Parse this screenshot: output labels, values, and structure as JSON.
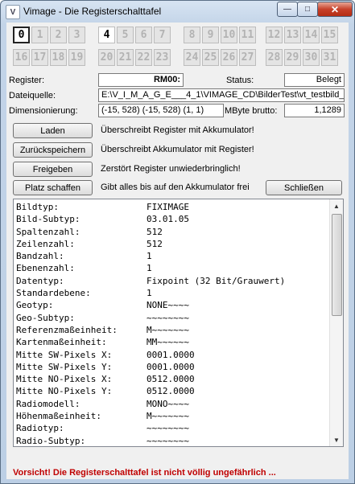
{
  "window": {
    "title": "Vimage - Die Registerschalttafel",
    "app_icon": "V"
  },
  "registers": [
    "0",
    "1",
    "2",
    "3",
    "4",
    "5",
    "6",
    "7",
    "8",
    "9",
    "10",
    "11",
    "12",
    "13",
    "14",
    "15",
    "16",
    "17",
    "18",
    "19",
    "20",
    "21",
    "22",
    "23",
    "24",
    "25",
    "26",
    "27",
    "28",
    "29",
    "30",
    "31"
  ],
  "active_register": "0",
  "filled_registers": [
    "4"
  ],
  "form": {
    "register_label": "Register:",
    "register_value": "RM00:",
    "status_label": "Status:",
    "status_value": "Belegt",
    "source_label": "Dateiquelle:",
    "source_value": "E:\\V_I_M_A_G_E___4_1\\VIMAGE_CD\\BilderTest\\vt_testbild_",
    "dim_label": "Dimensionierung:",
    "dim_value": "(-15, 528) (-15, 528) (1, 1)",
    "mbyte_label": "MByte brutto:",
    "mbyte_value": "1,1289"
  },
  "actions": {
    "load": "Laden",
    "load_desc": "Überschreibt Register mit Akkumulator!",
    "save_back": "Zurückspeichern",
    "save_back_desc": "Überschreibt Akkumulator mit Register!",
    "release": "Freigeben",
    "release_desc": "Zerstört Register unwiederbringlich!",
    "make_room": "Platz schaffen",
    "make_room_desc": "Gibt alles bis auf den Akkumulator frei",
    "close": "Schließen"
  },
  "properties": [
    [
      "Bildtyp:",
      "FIXIMAGE"
    ],
    [
      "Bild-Subtyp:",
      "03.01.05"
    ],
    [
      "Spaltenzahl:",
      "512"
    ],
    [
      "Zeilenzahl:",
      "512"
    ],
    [
      "Bandzahl:",
      "1"
    ],
    [
      "Ebenenzahl:",
      "1"
    ],
    [
      "Datentyp:",
      "Fixpoint (32 Bit/Grauwert)"
    ],
    [
      "Standardebene:",
      "1"
    ],
    [
      "Geotyp:",
      "NONE~~~~"
    ],
    [
      "Geo-Subtyp:",
      "~~~~~~~~"
    ],
    [
      "Referenzmaßeinheit:",
      "M~~~~~~~"
    ],
    [
      "Kartenmaßeinheit:",
      "MM~~~~~~"
    ],
    [
      "Mitte SW-Pixels X:",
      "0001.0000"
    ],
    [
      "Mitte SW-Pixels Y:",
      "0001.0000"
    ],
    [
      "Mitte NO-Pixels X:",
      "0512.0000"
    ],
    [
      "Mitte NO-Pixels Y:",
      "0512.0000"
    ],
    [
      "Radiomodell:",
      "MONO~~~~"
    ],
    [
      "Höhenmaßeinheit:",
      "M~~~~~~~"
    ],
    [
      "Radiotyp:",
      "~~~~~~~~"
    ],
    [
      "Radio-Subtyp:",
      "~~~~~~~~"
    ]
  ],
  "warning": "Vorsicht! Die Registerschalttafel ist nicht völlig ungefährlich ...",
  "icons": {
    "minimize": "minimize-icon",
    "maximize": "maximize-icon",
    "close": "close-icon",
    "scroll_up": "arrow-up-icon",
    "scroll_down": "arrow-down-icon"
  },
  "colors": {
    "warning": "#c00000",
    "close_button": "#c7412a"
  }
}
